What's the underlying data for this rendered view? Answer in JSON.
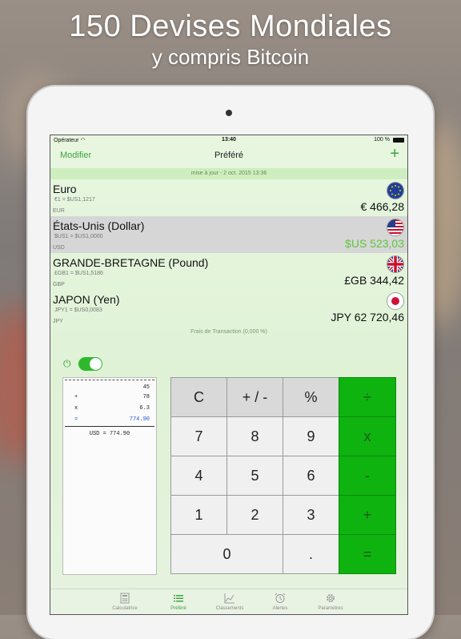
{
  "promo": {
    "line1": "150 Devises Mondiales",
    "line2": "y compris Bitcoin"
  },
  "status": {
    "carrier": "Opérateur",
    "time": "13:40",
    "battery": "100 %"
  },
  "nav": {
    "edit": "Modifier",
    "title": "Préféré",
    "add": "+"
  },
  "updated": "mise à jour - 2 oct. 2015 13:36",
  "currencies": [
    {
      "name": "Euro",
      "rate": "€1 =  $US1,1217",
      "code": "EUR",
      "amount": "€ 466,28",
      "flag": "eu-flag"
    },
    {
      "name": "États-Unis (Dollar)",
      "rate": "$US1 =  $US1,0000",
      "code": "USD",
      "amount": "$US 523,03",
      "flag": "us-flag"
    },
    {
      "name": "GRANDE-BRETAGNE (Pound)",
      "rate": "£GB1 =  $US1,5186",
      "code": "GBP",
      "amount": "£GB 344,42",
      "flag": "uk-flag"
    },
    {
      "name": "JAPON (Yen)",
      "rate": "JPY1 =  $US0,0083",
      "code": "JPY",
      "amount": "JPY 62 720,46",
      "flag": "jp-flag"
    }
  ],
  "fees": "Frais de Transaction (0,000 %)",
  "tape": {
    "lines": [
      {
        "op": "",
        "value": "45"
      },
      {
        "op": "+",
        "value": "78"
      },
      {
        "op": "x",
        "value": "6.3"
      },
      {
        "op": "=",
        "value": "774.90"
      }
    ],
    "result": "USD = 774.90"
  },
  "keys": {
    "c": "C",
    "pm": "+ / -",
    "pct": "%",
    "div": "÷",
    "k7": "7",
    "k8": "8",
    "k9": "9",
    "mul": "x",
    "k4": "4",
    "k5": "5",
    "k6": "6",
    "sub": "-",
    "k1": "1",
    "k2": "2",
    "k3": "3",
    "add": "+",
    "k0": "0",
    "dot": ".",
    "eq": "="
  },
  "tabs": [
    "Calculatrice",
    "Préféré",
    "Classements",
    "Alertes",
    "Paramètres"
  ],
  "colors": {
    "accent": "#3fa33f",
    "operator_keys": "#0fb30f",
    "highlight_amount": "#5cc73c"
  }
}
